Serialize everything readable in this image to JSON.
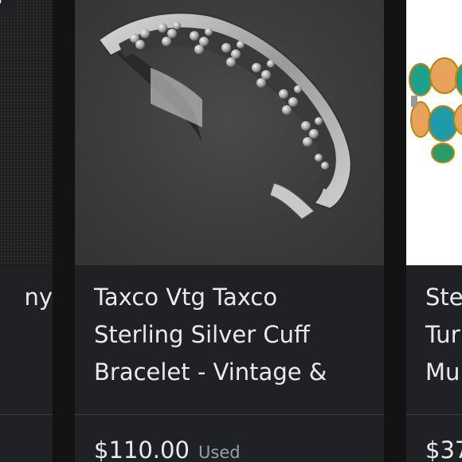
{
  "listings": [
    {
      "title_fragment": "ny",
      "image_desc": "dark textured fabric"
    },
    {
      "title_lines": [
        "Taxco Vtg Taxco",
        "Sterling Silver Cuff",
        "Bracelet - Vintage &"
      ],
      "price": "$110.00",
      "condition": "Used",
      "image_desc": "sterling silver cuff bracelet with beaded flower pattern"
    },
    {
      "title_lines": [
        "Ste",
        "Tur",
        "Mu"
      ],
      "price": "$37",
      "image_desc": "turquoise and orange stone bracelet"
    }
  ],
  "icons": {
    "save": "bookmark-icon"
  },
  "colors": {
    "page_bg": "#131314",
    "card_bg": "#202124",
    "text_primary": "#e8eaed",
    "text_secondary": "#9aa0a6",
    "divider": "#3c4043"
  }
}
